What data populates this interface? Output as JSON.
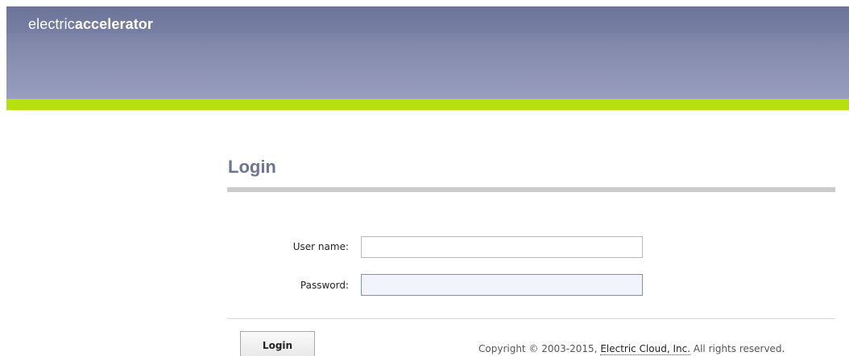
{
  "header": {
    "logo_light": "electric",
    "logo_bold": "accelerator"
  },
  "login": {
    "title": "Login",
    "username_label": "User name:",
    "username_value": "",
    "password_label": "Password:",
    "password_value": "",
    "button_label": "Login"
  },
  "footer": {
    "copyright_prefix": "Copyright © 2003-2015, ",
    "company_link": "Electric Cloud, Inc.",
    "copyright_suffix": " All rights reserved."
  },
  "colors": {
    "header_top": "#6d749a",
    "header_bottom": "#9096bb",
    "accent": "#b8e00f",
    "title": "#6e7494"
  }
}
